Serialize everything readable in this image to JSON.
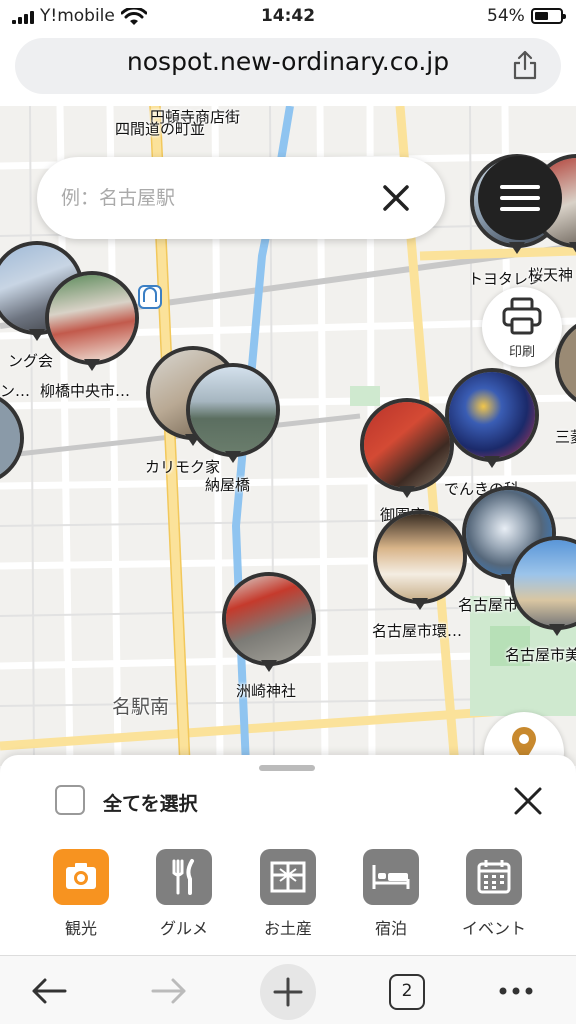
{
  "status_bar": {
    "carrier": "Y!mobile",
    "time": "14:42",
    "battery_pct": "54%"
  },
  "browser": {
    "url": "nospot.new-ordinary.co.jp",
    "tab_count": "2"
  },
  "search": {
    "placeholder": "例：名古屋駅"
  },
  "map": {
    "print_label": "印刷",
    "labels": {
      "l1": "円頓寺商店街",
      "l2": "四間道の町並",
      "l3": "トヨタレン",
      "l4": "桜天神",
      "l5": "ング会",
      "l6": "柳橋中央市…",
      "l7": "ン…",
      "l8": "カリモク家",
      "l9": "納屋橋",
      "l10": "三菱",
      "l11": "でんきの科…",
      "l12": "御園座",
      "l13": "名古屋市…",
      "l14": "名古屋市環…",
      "l15": "名古屋市美",
      "l16": "洲崎神社",
      "l17": "名駅南"
    }
  },
  "panel": {
    "select_all": "全てを選択",
    "categories": [
      {
        "label": "観光",
        "icon": "camera-icon"
      },
      {
        "label": "グルメ",
        "icon": "fork-knife-icon"
      },
      {
        "label": "お土産",
        "icon": "gift-icon"
      },
      {
        "label": "宿泊",
        "icon": "bed-icon"
      },
      {
        "label": "イベント",
        "icon": "calendar-icon"
      }
    ]
  },
  "colors": {
    "accent": "#f79320",
    "category_gray": "#7f7f7f",
    "map_bg": "#f2f1ee",
    "road_major": "#fbe29a",
    "river": "#8fc4f0"
  }
}
